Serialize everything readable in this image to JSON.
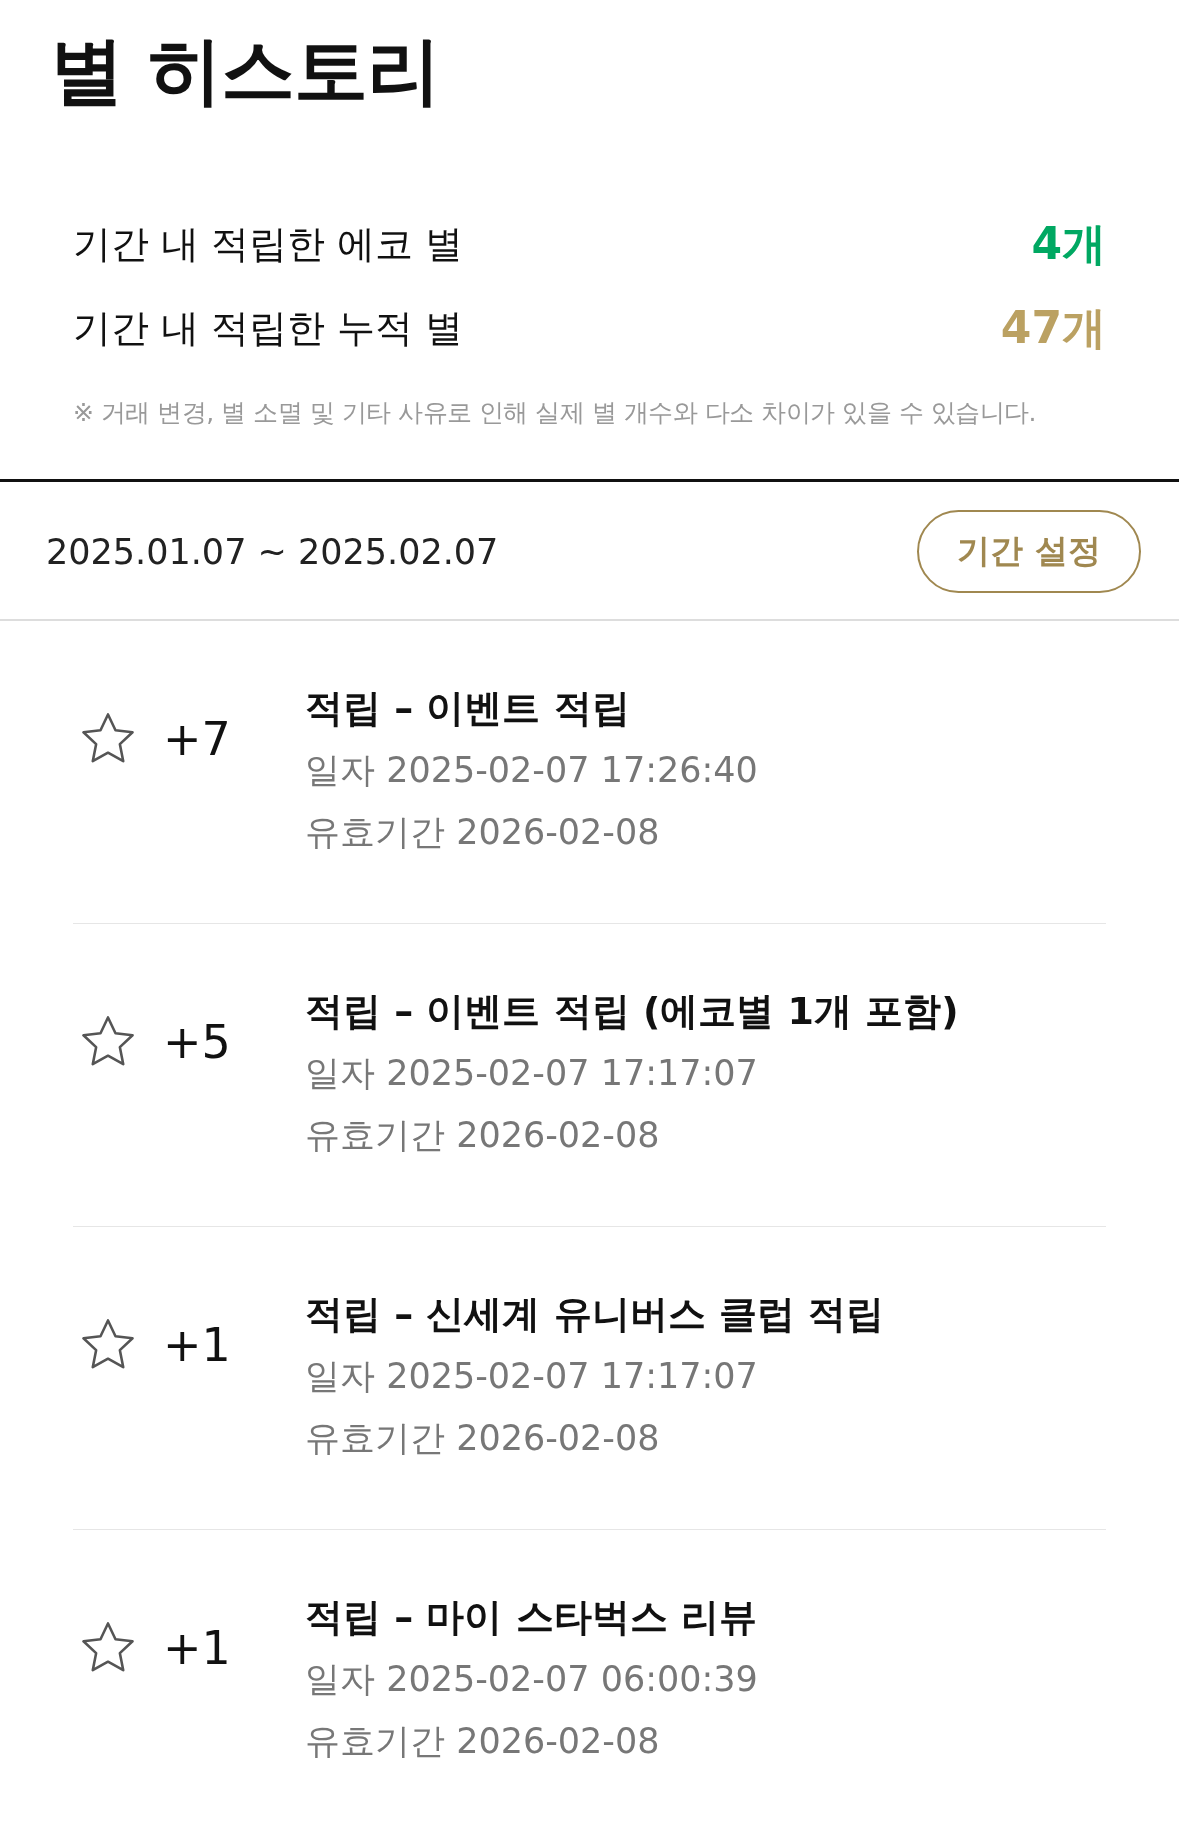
{
  "title": "별 히스토리",
  "summary": [
    {
      "label": "기간 내 적립한 에코 별",
      "value": "4개",
      "kind": "eco"
    },
    {
      "label": "기간 내 적립한 누적 별",
      "value": "47개",
      "kind": "total"
    }
  ],
  "note": "※ 거래 변경, 별 소멸 및 기타 사유로 인해 실제 별 개수와 다소 차이가 있을 수 있습니다.",
  "period": {
    "range": "2025.01.07 ~ 2025.02.07",
    "button": "기간 설정"
  },
  "history": [
    {
      "amount": "+7",
      "title": "적립 – 이벤트 적립",
      "date": "일자 2025-02-07 17:26:40",
      "expiry": "유효기간 2026-02-08"
    },
    {
      "amount": "+5",
      "title": "적립 – 이벤트 적립 (에코별 1개 포함)",
      "date": "일자 2025-02-07 17:17:07",
      "expiry": "유효기간 2026-02-08"
    },
    {
      "amount": "+1",
      "title": "적립 – 신세계 유니버스 클럽 적립",
      "date": "일자 2025-02-07 17:17:07",
      "expiry": "유효기간 2026-02-08"
    },
    {
      "amount": "+1",
      "title": "적립 – 마이 스타벅스 리뷰",
      "date": "일자 2025-02-07 06:00:39",
      "expiry": "유효기간 2026-02-08"
    }
  ]
}
